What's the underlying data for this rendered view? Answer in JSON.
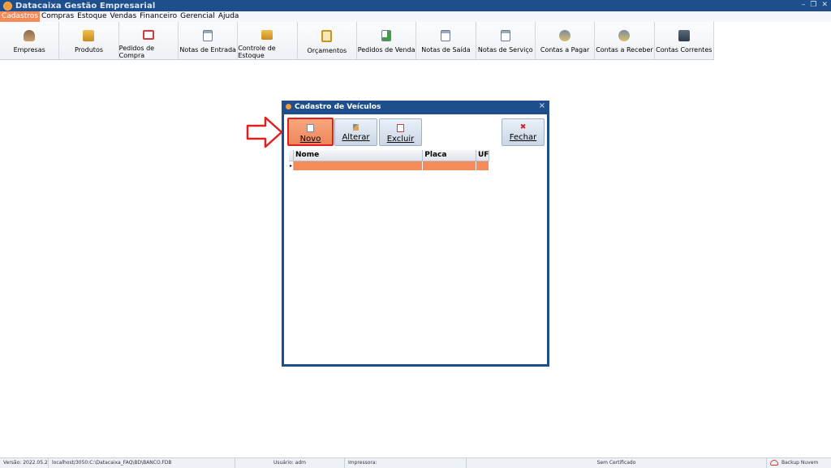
{
  "app": {
    "title": "Datacaixa Gestão Empresarial"
  },
  "menu": [
    "Cadastros",
    "Compras",
    "Estoque",
    "Vendas",
    "Financeiro",
    "Gerencial",
    "Ajuda"
  ],
  "toolbar": {
    "items": [
      {
        "label": "Empresas",
        "icon": "people-icon"
      },
      {
        "label": "Produtos",
        "icon": "box-icon"
      },
      {
        "label": "Pedidos de Compra",
        "icon": "order-doc-icon"
      },
      {
        "label": "Notas de Entrada",
        "icon": "invoice-in-icon"
      },
      {
        "label": "Controle de Estoque",
        "icon": "stock-icon"
      },
      {
        "label": "Orçamentos",
        "icon": "clipboard-icon"
      },
      {
        "label": "Pedidos de Venda",
        "icon": "sales-doc-icon"
      },
      {
        "label": "Notas de Saída",
        "icon": "invoice-out-icon"
      },
      {
        "label": "Notas de Serviço",
        "icon": "service-doc-icon"
      },
      {
        "label": "Contas a Pagar",
        "icon": "pay-icon"
      },
      {
        "label": "Contas a Receber",
        "icon": "receive-icon"
      },
      {
        "label": "Contas Correntes",
        "icon": "safe-icon"
      }
    ]
  },
  "dialog": {
    "title": "Cadastro de Veículos",
    "buttons": {
      "novo": "Novo",
      "alterar": "Alterar",
      "excluir": "Excluir",
      "fechar": "Fechar"
    },
    "grid": {
      "columns": [
        "Nome",
        "Placa",
        "UF"
      ]
    }
  },
  "status": {
    "version": "Versão: 2022.05.23",
    "db": "localhost/3050:C:\\Datacaixa_FAQ\\BD\\BANCO.FDB",
    "user": "Usuário: adm",
    "printer": "Impressora:",
    "cert": "Sem Certificado",
    "backup": "Backup Nuvem"
  },
  "colors": {
    "title_bar": "#1f4e8c",
    "accent": "#f58b5a",
    "highlight_border": "#e02020"
  }
}
